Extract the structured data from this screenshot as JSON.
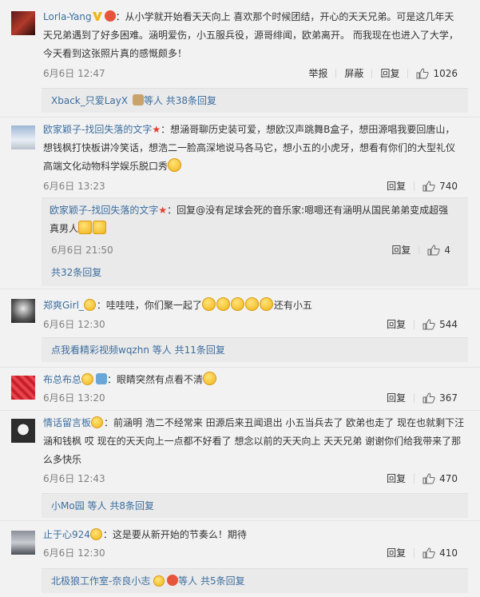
{
  "comments": [
    {
      "user": "Lorla-Yang",
      "text": "：从小学就开始看天天向上 喜欢那个时候团结，开心的天天兄弟。可是这几年天天兄弟遇到了好多困难。涵明爱伤，小五服兵役，源哥绯闻，欧弟离开。   而我现在也进入了大学，今天看到这张照片真的感慨颇多！",
      "time": "6月6日 12:47",
      "report": "举报",
      "block": "屏蔽",
      "reply": "回复",
      "likes": "1026",
      "sub_user": "Xback_只爱LayX",
      "sub_rest": "等人 共38条回复"
    },
    {
      "user": "欧家颖子-找回失落的文字",
      "text": "：想涵哥聊历史装可爱，想欧汉声跳舞B盒子，想田源唱我要回唐山，想钱枫打快板讲冷笑话，想浩二一脸高深地说马各马它，想小五的小虎牙，想看有你们的大型礼仪高端文化动物科学娱乐脱口秀",
      "time": "6月6日 13:23",
      "reply": "回复",
      "likes": "740",
      "nested": {
        "user": "欧家颖子-找回失落的文字",
        "text": "：回复@没有足球会死的音乐家:嗯嗯还有涵明从国民弟弟变成超强真男人",
        "time": "6月6日 21:50",
        "reply": "回复",
        "likes": "4"
      },
      "sub_rest": "共32条回复"
    },
    {
      "user": "郑爽Girl_",
      "text": "：哇哇哇，你们聚一起了",
      "text_after": "还有小五",
      "time": "6月6日 12:30",
      "reply": "回复",
      "likes": "544",
      "sub_user": "点我看精彩视频wqzhn",
      "sub_rest": "等人 共11条回复"
    },
    {
      "user": "布总布总",
      "text": "：眼睛突然有点看不清",
      "time": "6月6日 13:20",
      "reply": "回复",
      "likes": "367"
    },
    {
      "user": "情话留言板",
      "text": "：前涵明 浩二不经常来 田源后来丑闻退出 小五当兵去了 欧弟也走了 现在也就剩下汪涵和钱枫 哎 现在的天天向上一点都不好看了 想念以前的天天向上 天天兄弟 谢谢你们给我带来了那么多快乐",
      "time": "6月6日 12:43",
      "reply": "回复",
      "likes": "470",
      "sub_user": "小Mo园",
      "sub_rest": "等人 共8条回复"
    },
    {
      "user": "止于心924",
      "text": "：这是要从新开始的节奏么！期待",
      "time": "6月6日 12:30",
      "reply": "回复",
      "likes": "410",
      "sub_user": "北极狼工作室-奈良小志",
      "sub_rest": "等人 共5条回复"
    }
  ],
  "colors": {
    "username": "#eb7350",
    "link": "#3c6e9f",
    "meta": "#808080"
  }
}
